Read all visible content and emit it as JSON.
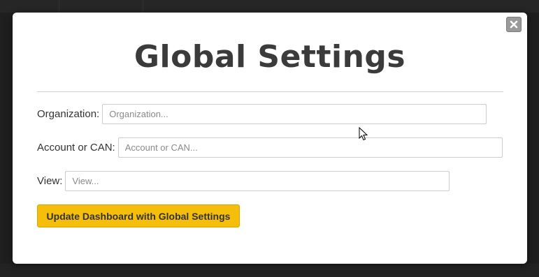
{
  "modal": {
    "title": "Global Settings",
    "close_icon": "close-icon",
    "fields": [
      {
        "label": "Organization:",
        "placeholder": "Organization...",
        "value": ""
      },
      {
        "label": "Account or CAN:",
        "placeholder": "Account or CAN...",
        "value": ""
      },
      {
        "label": "View:",
        "placeholder": "View...",
        "value": ""
      }
    ],
    "submit_label": "Update Dashboard with Global Settings"
  },
  "colors": {
    "accent": "#f5be0b",
    "title_text": "#3b3b3b",
    "overlay": "#1f1f1f",
    "close_button": "#9a9a9a"
  },
  "cursor_icon": "arrow-cursor-icon"
}
